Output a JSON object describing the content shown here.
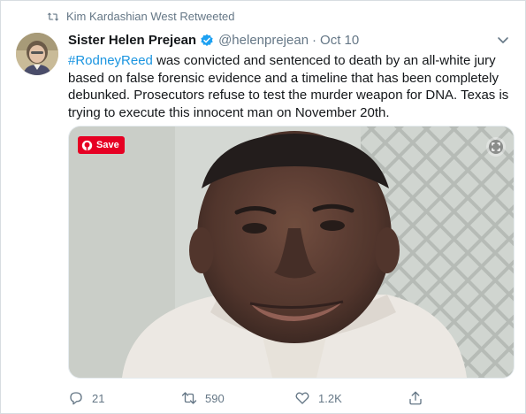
{
  "retweet": {
    "label": "Kim Kardashian West Retweeted"
  },
  "tweet": {
    "author_name": "Sister Helen Prejean",
    "handle": "@helenprejean",
    "separator": "·",
    "date": "Oct 10",
    "hashtag": "#RodneyReed",
    "body": " was convicted and sentenced to death by an all-white jury based on false forensic evidence and a timeline that has been completely debunked. Prosecutors refuse to test the murder weapon for DNA. Texas is trying to execute this innocent man on November 20th."
  },
  "media": {
    "save_label": "Save",
    "icons": [
      "pinterest-icon",
      "expand-icon"
    ]
  },
  "actions": {
    "replies": "21",
    "retweets": "590",
    "likes": "1.2K",
    "icons": [
      "reply-icon",
      "retweet-icon",
      "like-icon",
      "share-icon"
    ]
  },
  "colors": {
    "link": "#1b95e0",
    "muted": "#657786",
    "verified": "#1da1f2",
    "pinterest": "#e60023"
  }
}
